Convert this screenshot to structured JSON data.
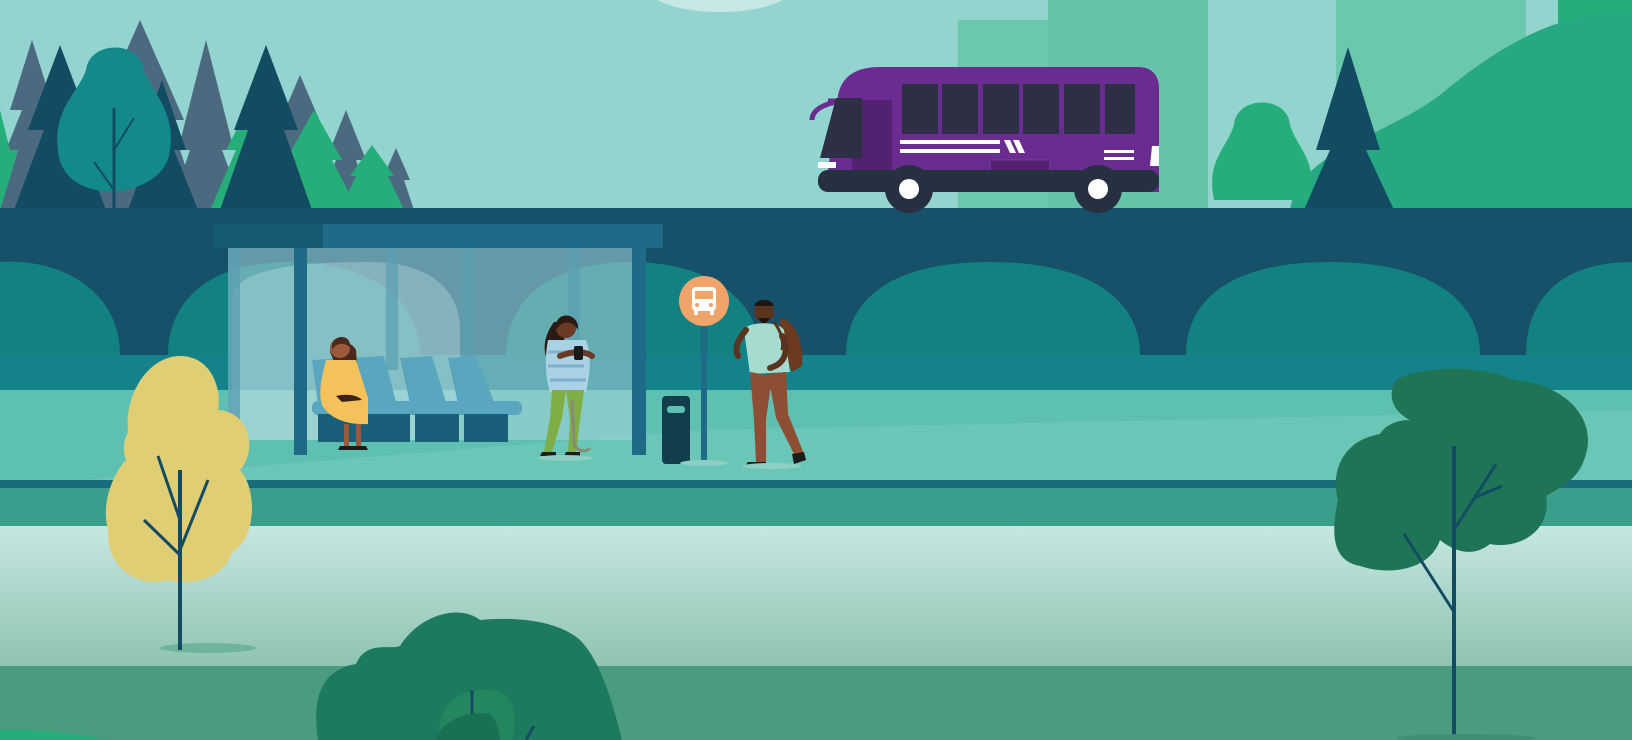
{
  "scene": {
    "description_free": true,
    "palette": {
      "sky": "#93d4cf",
      "building_light": "#6bc8ac",
      "building_mid": "#66c2a8",
      "tree_dark": "#124b62",
      "tree_slate": "#4b6a80",
      "tree_green": "#25ae7a",
      "tree_teal": "#14898b",
      "viaduct": "#16506a",
      "viaduct_arch": "#128182",
      "viaduct_lower": "#14838a",
      "ground": "#5ec0b1",
      "platform": "#6ac6b6",
      "curb": "#1a6b7c",
      "road_edge": "#3a9e8d",
      "mist_top": "#c2e6e1",
      "mist_bottom": "#8ec4b2",
      "grass": "#4a9b80",
      "bus": "#6a2c91",
      "bus_dark": "#52216f",
      "bus_window": "#2d2f45",
      "tyre": "#263040",
      "shelter": "#1e6a87",
      "shelter_roof": "#155a73",
      "glass": "#a8d3da",
      "seat": "#5aa6bf",
      "seat_base": "#1a5f7a",
      "stop_sign": "#f0a46a",
      "bin": "#123d4d",
      "yellow_tree": "#e0ce74",
      "dark_green_tree": "#1f7456",
      "bush_green": "#1d7a5e"
    },
    "people": [
      {
        "id": "seated-woman",
        "dress": "#f5c15a",
        "skin": "#9a5a3a"
      },
      {
        "id": "standing-woman-phone",
        "top": "#a9d2e6",
        "pants": "#7fae46",
        "skin": "#6b3a24"
      },
      {
        "id": "man-with-backpack",
        "top": "#a6dccf",
        "pants": "#8d4e33",
        "skin": "#5a341f",
        "bag": "#6b3a1f"
      }
    ],
    "bus_sign_icon": "bus-icon"
  }
}
